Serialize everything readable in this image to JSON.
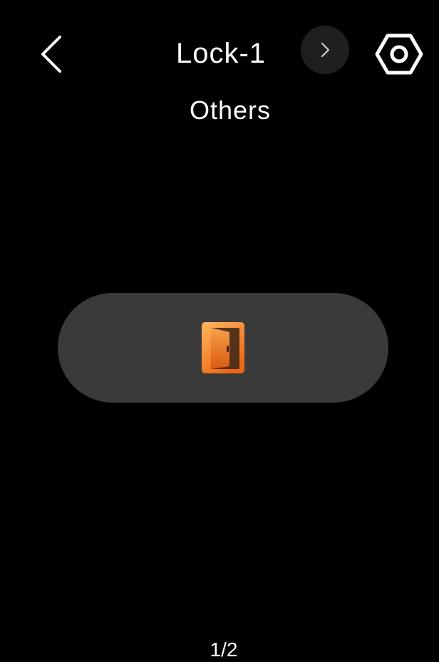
{
  "header": {
    "title": "Lock-1",
    "subtitle": "Others"
  },
  "icons": {
    "back": "chevron-left-icon",
    "next": "chevron-right-icon",
    "settings": "hexagon-gear-icon",
    "door": "door-open-icon"
  },
  "colors": {
    "background": "#000000",
    "pill": "#3a3a3a",
    "next_button_bg": "#1f1f1f",
    "door_gradient_start": "#ffb15a",
    "door_gradient_end": "#ee6a18"
  },
  "pager": {
    "text": "1/2"
  }
}
